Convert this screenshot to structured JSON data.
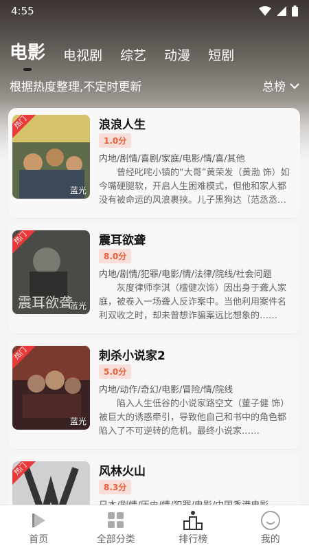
{
  "status_bar": {
    "time": "4:55"
  },
  "tabs": [
    {
      "label": "电影",
      "active": true
    },
    {
      "label": "电视剧",
      "active": false
    },
    {
      "label": "综艺",
      "active": false
    },
    {
      "label": "动漫",
      "active": false
    },
    {
      "label": "短剧",
      "active": false
    }
  ],
  "subheader": {
    "note": "根据热度整理,不定时更新",
    "rank_label": "总榜"
  },
  "movies": [
    {
      "title": "浪浪人生",
      "score": "1.0分",
      "tags": "内地/剧情/喜剧/家庭/电影/情/喜/其他",
      "desc": "曾经叱咤小镇的“大哥”黄荣发（黄渤 饰）如今嘴硬腿软，开启人生困难模式，但他和家人都没有被命运的风浪裹挟。儿子黑狗达（范丞丞 饰）……",
      "badge": "热门",
      "quality": "蓝光",
      "poster_colors": [
        "#c9b27a",
        "#6a5a3a"
      ]
    },
    {
      "title": "震耳欲聋",
      "score": "8.0分",
      "tags": "内地/剧情/犯罪/电影/情/法律/院线/社会问题",
      "desc": "灰度律师李淇（檀健次饰）因出身于聋人家庭，被卷入一场聋人反诈案中。当他利用案件名利双收之时，却未曾想诈骗案远比想象的……",
      "badge": "热门",
      "quality": "蓝光",
      "poster_colors": [
        "#6e6e68",
        "#2e2e2c"
      ]
    },
    {
      "title": "刺杀小说家2",
      "score": "5.0分",
      "tags": "内地/动作/奇幻/电影/冒险/情/院线",
      "desc": "陷入人生低谷的小说家路空文（董子健 饰）被巨大的诱惑牵引，导致他自己和书中的角色都陷入了不可逆转的危机。最终小说家……",
      "badge": "热门",
      "quality": "蓝光",
      "poster_colors": [
        "#8a3a30",
        "#2a1a1a"
      ]
    },
    {
      "title": "风林火山",
      "score": "8.3分",
      "tags": "日本/剧情/历史/情/犯罪/电影/中国香港电影",
      "desc": "",
      "badge": "热门",
      "quality": "",
      "poster_colors": [
        "#c8c8c8",
        "#3a3a3a"
      ]
    }
  ],
  "bottom_nav": [
    {
      "label": "首页",
      "icon": "play-icon"
    },
    {
      "label": "全部分类",
      "icon": "grid-icon"
    },
    {
      "label": "排行榜",
      "icon": "podium-icon"
    },
    {
      "label": "我的",
      "icon": "smile-icon"
    }
  ]
}
